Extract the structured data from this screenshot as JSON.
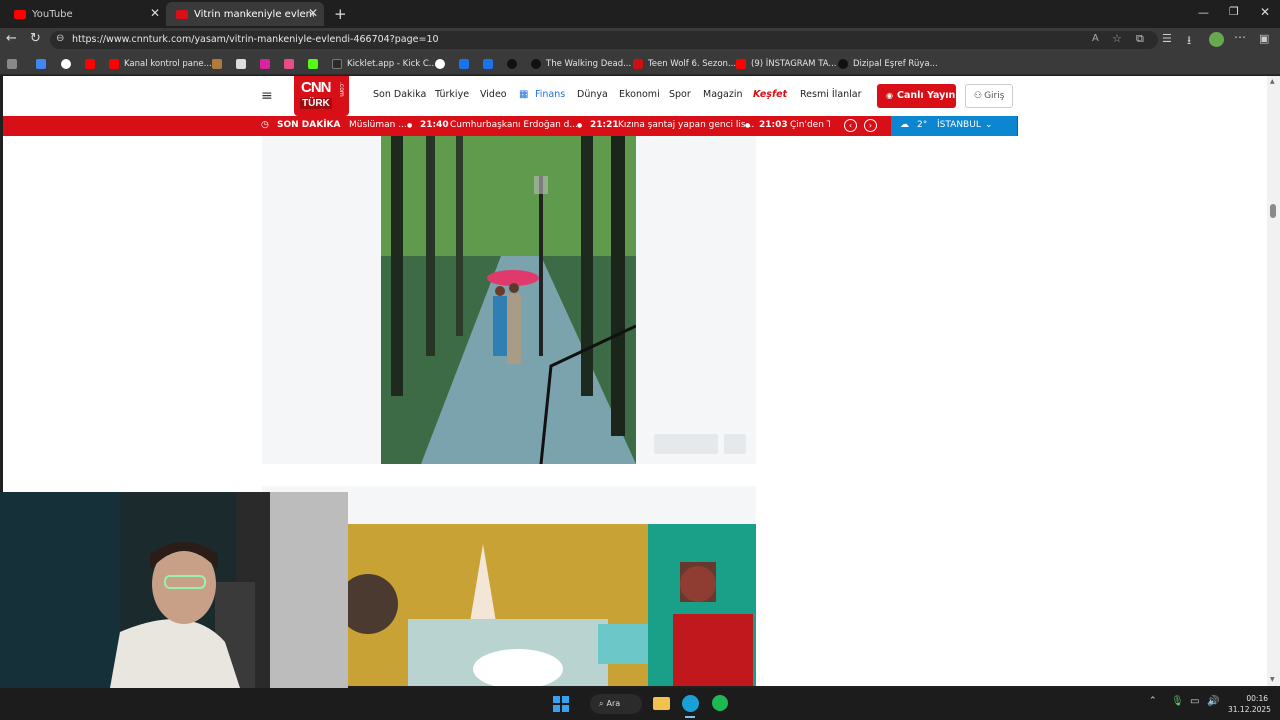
{
  "browser": {
    "tabs": [
      {
        "title": "YouTube",
        "color": "#ff0000"
      },
      {
        "title": "Vitrin mankeniyle evlendi - Gazete",
        "color": "#d80f16"
      }
    ],
    "url": "https://www.cnnturk.com/yasam/vitrin-mankeniyle-evlendi-466704?page=10",
    "bookmarks": [
      {
        "label": "Kanal kontrol pane...",
        "color": "#ff0000"
      },
      {
        "label": "Kicklet.app - Kick C...",
        "color": "#2b2b2b"
      },
      {
        "label": "The Walking Dead...",
        "color": "#3a3a3a"
      },
      {
        "label": "Teen Wolf 6. Sezon...",
        "color": "#cc1111"
      },
      {
        "label": "(9) İNSTAGRAM TA...",
        "color": "#ff0000"
      },
      {
        "label": "Dizipal Eşref Rüya...",
        "color": "#111111"
      }
    ]
  },
  "site": {
    "logo_top": "CNN",
    "logo_bottom": "TÜRK",
    "logo_side": ".com",
    "nav": [
      "Son Dakika",
      "Türkiye",
      "Video",
      "Finans",
      "Dünya",
      "Ekonomi",
      "Spor",
      "Magazin",
      "Keşfet",
      "Resmi İlanlar"
    ],
    "live_button": "Canlı Yayın",
    "login_button": "Giriş",
    "breaking_label": "SON DAKİKA",
    "ticker": [
      {
        "time": "",
        "text": "Müslüman ..."
      },
      {
        "time": "21:40",
        "text": "Cumhurbaşkanı Erdoğan d..."
      },
      {
        "time": "21:21",
        "text": "Kızına şantaj yapan genci lis..."
      },
      {
        "time": "21:03",
        "text": "Çin'den T"
      }
    ],
    "weather_temp": "2°",
    "weather_city": "İSTANBUL",
    "brand_red": "#d80f16",
    "weather_blue": "#0c86d0"
  },
  "taskbar": {
    "search_label": "Ara",
    "time": "00:16",
    "date": "31.12.2025"
  }
}
